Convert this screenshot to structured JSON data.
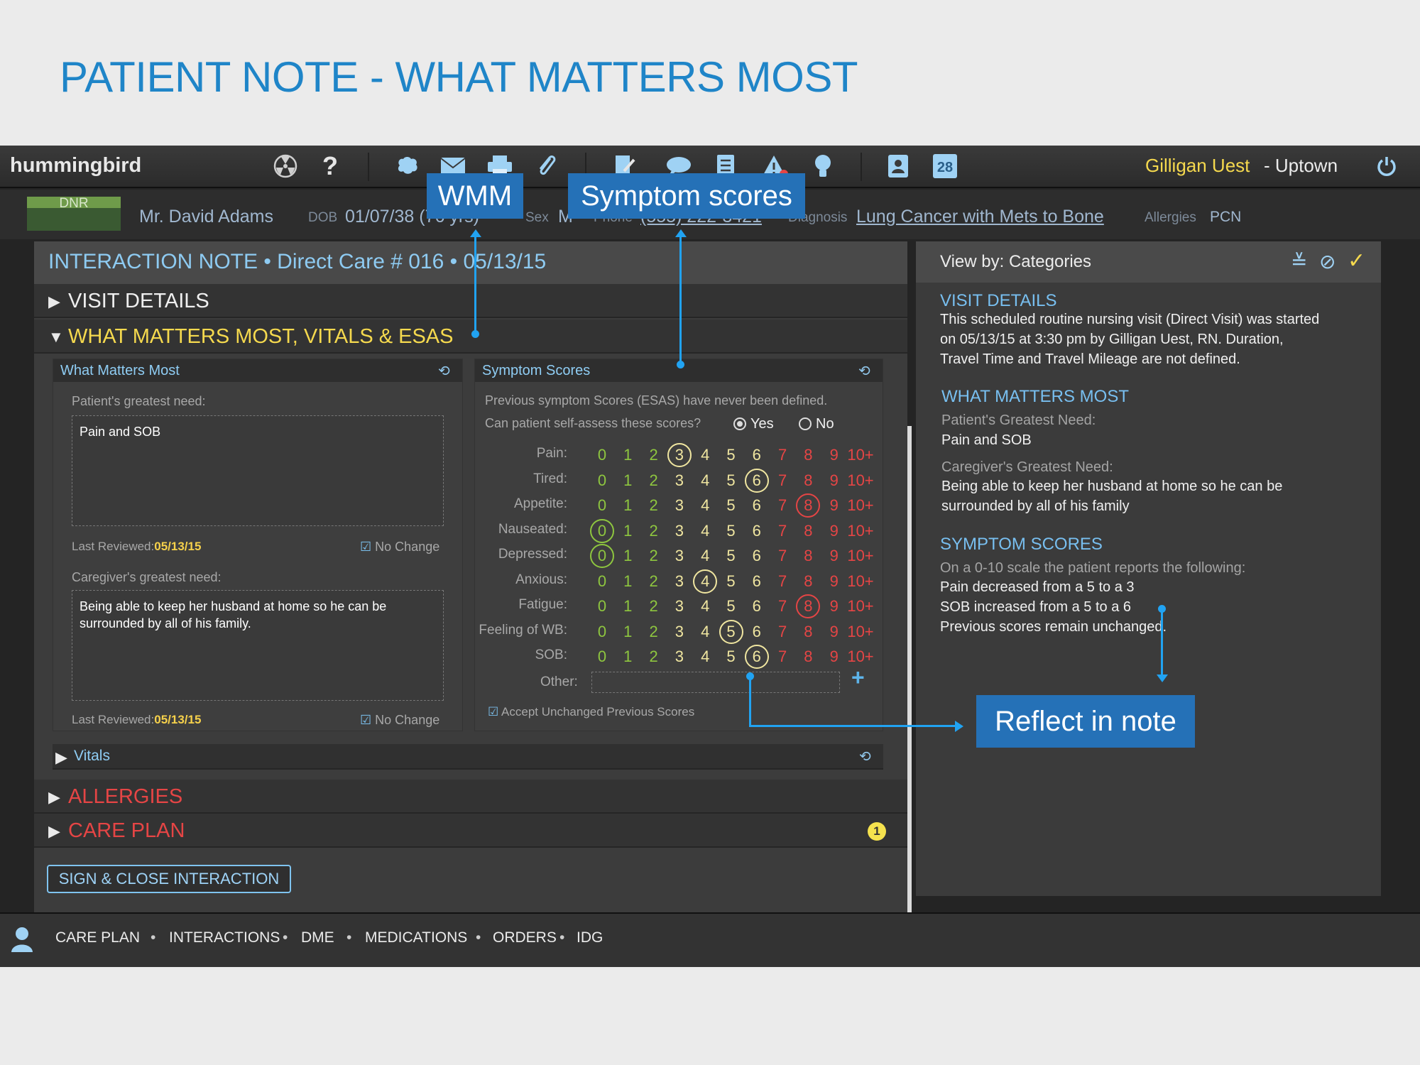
{
  "slide_title": "PATIENT NOTE - WHAT MATTERS MOST",
  "app": {
    "brand": "hummingbird",
    "user_name": "Gilligan Uest",
    "user_location": "- Uptown",
    "calendar_day": "28",
    "colors": {
      "accent": "#5db4ea",
      "yellow": "#f5d94e",
      "red": "#e54545",
      "green": "#8ec63f"
    }
  },
  "patient": {
    "dnr": "DNR",
    "name": "Mr. David Adams",
    "dob_label": "DOB",
    "dob": "01/07/38 (76 yrs)",
    "sex_label": "Sex",
    "sex": "M",
    "phone_label": "Phone",
    "phone": "(555) 222-3421",
    "dx_label": "Diagnosis",
    "diagnosis": "Lung Cancer with Mets to Bone",
    "allergies_label": "Allergies",
    "allergies": "PCN"
  },
  "note": {
    "title": "INTERACTION NOTE • Direct Care # 016 • 05/13/15",
    "sections": {
      "visit_details": "VISIT DETAILS",
      "wmm_vitals": "WHAT MATTERS MOST, VITALS & ESAS",
      "vitals": "Vitals",
      "allergies": "ALLERGIES",
      "care_plan": "CARE PLAN",
      "care_plan_badge": "1"
    },
    "wmm": {
      "title": "What Matters Most",
      "patient_label": "Patient's greatest need:",
      "patient_value": "Pain and SOB",
      "last_reviewed_label": "Last Reviewed:",
      "last_reviewed_1": "05/13/15",
      "no_change": "No Change",
      "caregiver_label": "Caregiver's greatest need:",
      "caregiver_value": "Being able to keep her husband at home so he can be surrounded by all of his family.",
      "last_reviewed_2": "05/13/15"
    },
    "symptoms": {
      "title": "Symptom Scores",
      "previous_note": "Previous symptom Scores (ESAS) have never been defined.",
      "self_assess_q": "Can patient self-assess these scores?",
      "yes": "Yes",
      "no": "No",
      "scale": [
        "0",
        "1",
        "2",
        "3",
        "4",
        "5",
        "6",
        "7",
        "8",
        "9",
        "10+"
      ],
      "rows": [
        {
          "label": "Pain:",
          "selected": 3
        },
        {
          "label": "Tired:",
          "selected": 6
        },
        {
          "label": "Appetite:",
          "selected": 8
        },
        {
          "label": "Nauseated:",
          "selected": 0
        },
        {
          "label": "Depressed:",
          "selected": 0
        },
        {
          "label": "Anxious:",
          "selected": 4
        },
        {
          "label": "Fatigue:",
          "selected": 8
        },
        {
          "label": "Feeling of WB:",
          "selected": 5
        },
        {
          "label": "SOB:",
          "selected": 6
        }
      ],
      "other_label": "Other:",
      "accept_label": "Accept Unchanged Previous Scores"
    },
    "sign_button": "SIGN & CLOSE INTERACTION"
  },
  "summary": {
    "view_by": "View by: Categories",
    "visit_h": "VISIT DETAILS",
    "visit_lines": [
      "This scheduled routine nursing visit (Direct Visit) was started",
      "on 05/13/15 at 3:30 pm by Gilligan Uest, RN. Duration,",
      "Travel Time and Travel Mileage are not defined."
    ],
    "wmm_h": "WHAT MATTERS MOST",
    "patient_need_label": "Patient's Greatest Need:",
    "patient_need": "Pain and SOB",
    "caregiver_need_label": "Caregiver's Greatest Need:",
    "caregiver_lines": [
      "Being able to keep her husband at home so he can be",
      "surrounded by all of his family"
    ],
    "sym_h": "SYMPTOM SCORES",
    "scale_note": "On a 0-10 scale the patient reports the following:",
    "sym_lines": [
      "Pain decreased from a 5 to a 3",
      "SOB increased from a 5 to a 6",
      "Previous scores remain unchanged."
    ]
  },
  "bottom_nav": [
    "CARE PLAN",
    "INTERACTIONS",
    "DME",
    "MEDICATIONS",
    "ORDERS",
    "IDG"
  ],
  "callouts": {
    "wmm": "WMM",
    "symptom": "Symptom scores",
    "reflect": "Reflect in note"
  }
}
